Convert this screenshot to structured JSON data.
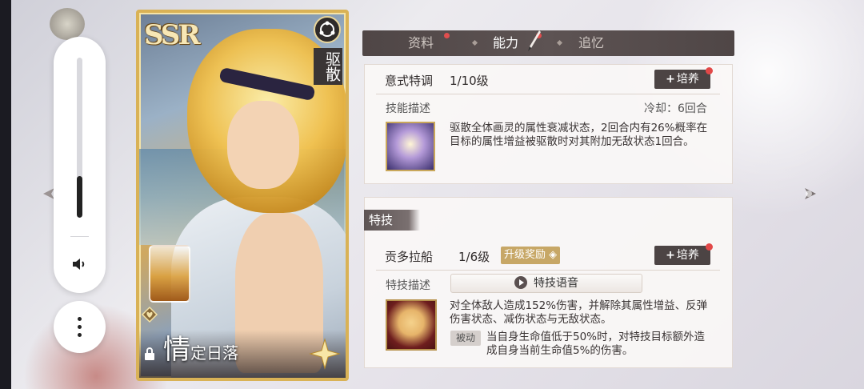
{
  "volume": {
    "level": 0.26,
    "speaker_icon": "speaker-icon",
    "more_icon": "more-vertical-icon"
  },
  "card": {
    "rarity": "SSR",
    "type_label": "驱散",
    "name_big": "情",
    "name_rest": "定日落",
    "icons": [
      "sun-emblem-icon",
      "heart-icon",
      "lock-icon",
      "star-decor-icon"
    ]
  },
  "tabs": [
    {
      "label": "资料",
      "active": false,
      "badge": true
    },
    {
      "label": "能力",
      "active": true,
      "badge": true
    },
    {
      "label": "追忆",
      "active": false,
      "badge": false
    }
  ],
  "skill": {
    "name": "意式特调",
    "level": "1/10级",
    "grow_label": "培养",
    "desc_title": "技能描述",
    "cooldown": "冷却：6回合",
    "description": "驱散全体画灵的属性衰减状态，2回合内有26%概率在目标的属性增益被驱散时对其附加无敌状态1回合。"
  },
  "special": {
    "section_title": "特技",
    "name": "贡多拉船",
    "level": "1/6级",
    "upgrade_reward": "升级奖励",
    "grow_label": "培养",
    "desc_title": "特技描述",
    "voice_label": "特技语音",
    "description": "对全体敌人造成152%伤害，并解除其属性增益、反弹伤害状态、减伤状态与无敌状态。",
    "passive_tag": "被动",
    "passive_desc": "当自身生命值低于50%时，对特技目标额外造成自身当前生命值5%的伤害。"
  },
  "colors": {
    "accent_gold": "#d9b256",
    "tab_bar": "#4f4646",
    "badge_red": "#e24848"
  }
}
